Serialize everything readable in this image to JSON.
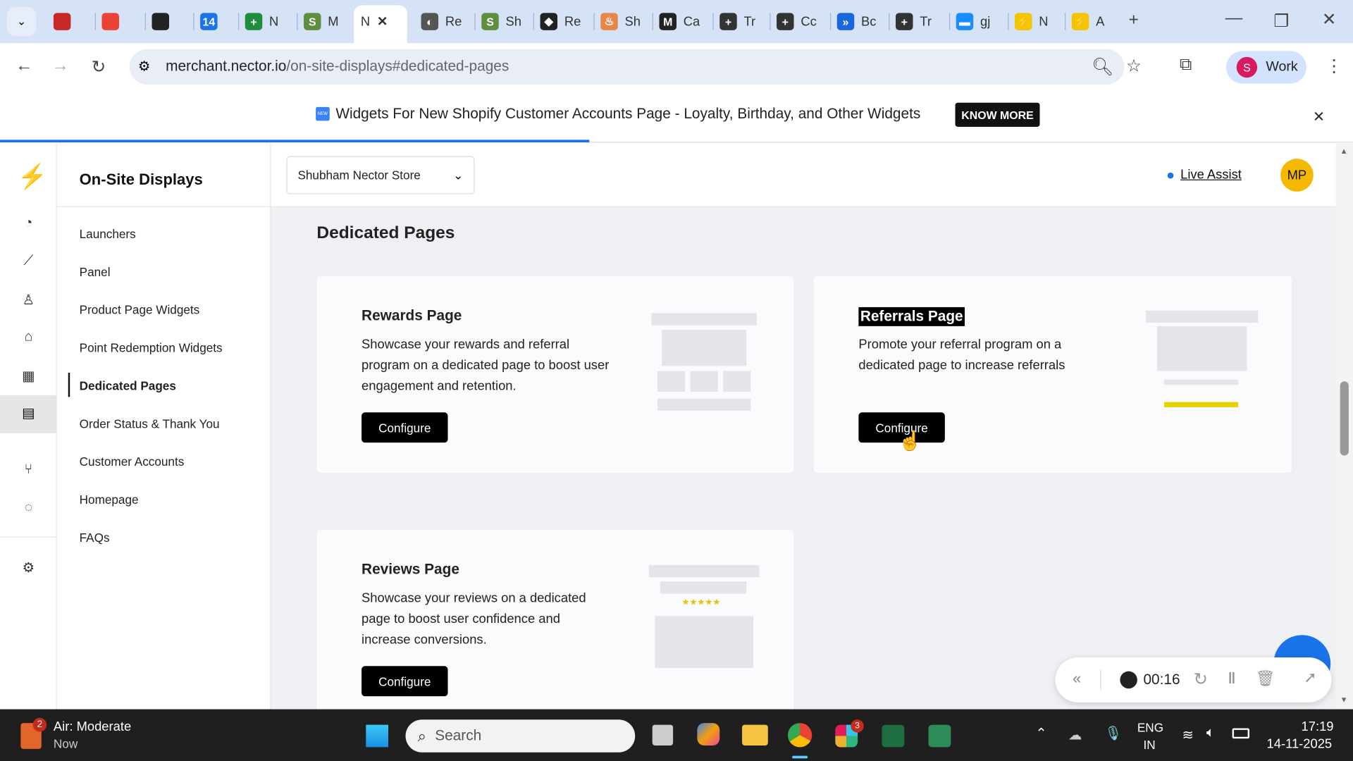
{
  "browser": {
    "tabs": [
      {
        "label": "",
        "icon": "record-icon",
        "color": "#c62828"
      },
      {
        "label": "",
        "icon": "gmail-icon",
        "color": "#ea4335"
      },
      {
        "label": "",
        "icon": "chatgpt-icon",
        "color": "#222"
      },
      {
        "label": "",
        "icon": "calendar-icon",
        "color": "#1a73e8",
        "glyph": "14"
      },
      {
        "label": "N",
        "icon": "sheets-icon",
        "color": "#1e8e3e",
        "glyph": "+"
      },
      {
        "label": "M",
        "icon": "shopify-icon",
        "color": "#5e8e3e",
        "glyph": "S"
      },
      {
        "label": "N",
        "icon": "nector-icon",
        "active": true
      },
      {
        "label": "Re",
        "icon": "globe-icon",
        "color": "#555",
        "glyph": "◐"
      },
      {
        "label": "Sh",
        "icon": "shopify-icon",
        "color": "#5e8e3e",
        "glyph": "S"
      },
      {
        "label": "Re",
        "icon": "diamond-icon",
        "color": "#222",
        "glyph": "◆"
      },
      {
        "label": "Sh",
        "icon": "flame-icon",
        "color": "#e8864a",
        "glyph": "♨"
      },
      {
        "label": "Ca",
        "icon": "canva-icon",
        "color": "#222",
        "glyph": "M"
      },
      {
        "label": "Tr",
        "icon": "tab-icon",
        "color": "#333",
        "glyph": "+"
      },
      {
        "label": "Cc",
        "icon": "tab-icon",
        "color": "#333",
        "glyph": "+"
      },
      {
        "label": "Bc",
        "icon": "jira-icon",
        "color": "#1868db",
        "glyph": "»"
      },
      {
        "label": "Tr",
        "icon": "tab-icon",
        "color": "#333",
        "glyph": "+"
      },
      {
        "label": "gj",
        "icon": "chat-icon",
        "color": "#1a8cff",
        "glyph": "▬"
      },
      {
        "label": "N",
        "icon": "bolt-icon",
        "color": "#f5c400",
        "glyph": "⚡"
      },
      {
        "label": "A",
        "icon": "bolt-icon",
        "color": "#f5c400",
        "glyph": "⚡"
      }
    ],
    "url_host": "merchant.nector.io",
    "url_path": "/on-site-displays#dedicated-pages",
    "profile_initial": "S",
    "profile_label": "Work"
  },
  "banner": {
    "text": "Widgets For New Shopify Customer Accounts Page - Loyalty, Birthday, and Other Widgets",
    "new_badge": "NEW",
    "button": "KNOW MORE",
    "close": "×"
  },
  "sidebar": {
    "title": "On-Site Displays",
    "items": [
      {
        "label": "Launchers"
      },
      {
        "label": "Panel"
      },
      {
        "label": "Product Page Widgets"
      },
      {
        "label": "Point Redemption Widgets"
      },
      {
        "label": "Dedicated Pages",
        "active": true
      },
      {
        "label": "Order Status & Thank You"
      },
      {
        "label": "Customer Accounts"
      },
      {
        "label": "Homepage"
      },
      {
        "label": "FAQs"
      }
    ]
  },
  "header": {
    "store": "Shubham Nector Store",
    "live_assist": "Live Assist",
    "avatar": "MP"
  },
  "main": {
    "title": "Dedicated Pages",
    "cards": [
      {
        "title": "Rewards Page",
        "desc": "Showcase your rewards and referral program on a dedicated page to boost user engagement and retention.",
        "button": "Configure"
      },
      {
        "title": "Referrals Page",
        "desc": "Promote your referral program on a dedicated page to increase referrals",
        "button": "Configure"
      },
      {
        "title": "Reviews Page",
        "desc": "Showcase your reviews on a dedicated page to boost user confidence and increase conversions.",
        "button": "Configure",
        "stars": "★★★★★"
      }
    ]
  },
  "recorder": {
    "time": "00:16"
  },
  "taskbar": {
    "weather_badge": "2",
    "weather_title": "Air: Moderate",
    "weather_sub": "Now",
    "search": "Search",
    "slack_badge": "3",
    "lang1": "ENG",
    "lang2": "IN",
    "time": "17:19",
    "date": "14-11-2025"
  }
}
